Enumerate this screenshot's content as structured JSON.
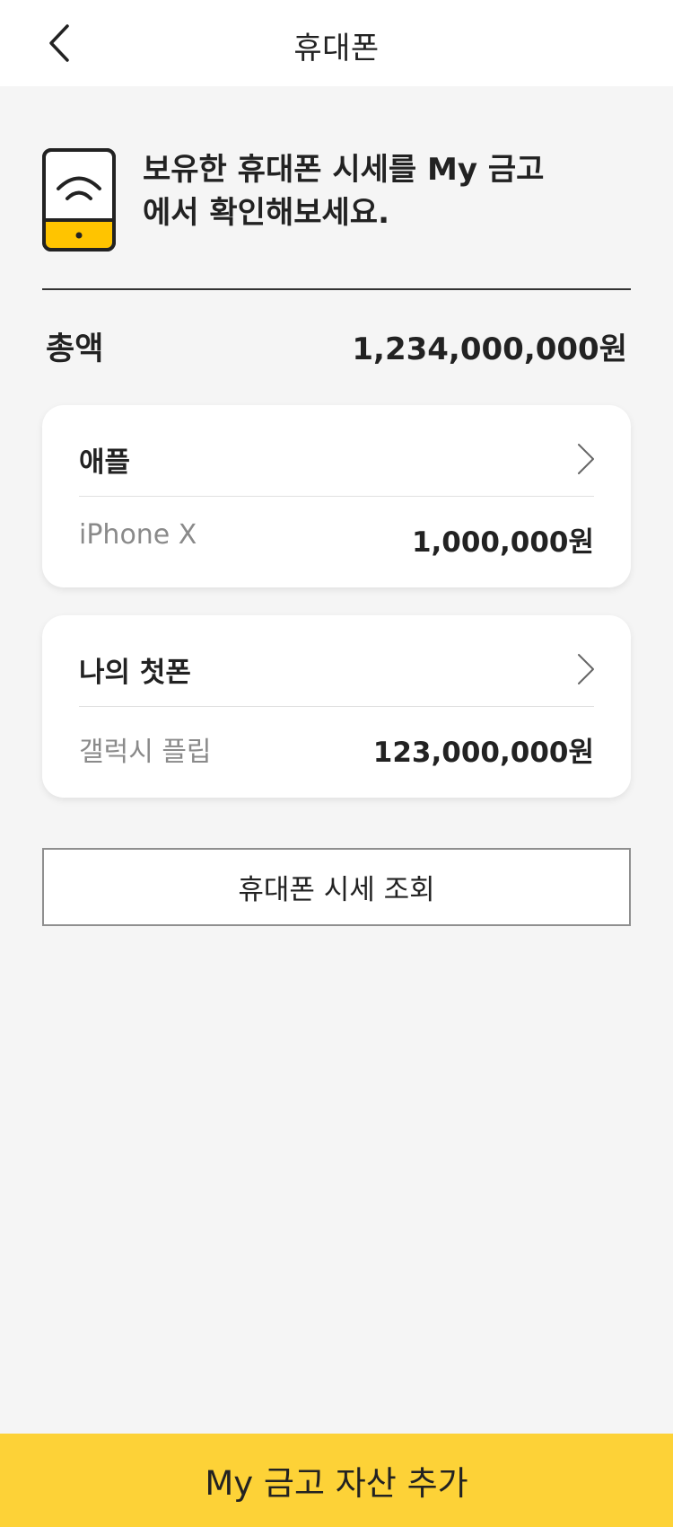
{
  "header": {
    "title": "휴대폰",
    "back_icon": "chevron-left-icon"
  },
  "intro": {
    "icon": "phone-wifi-icon",
    "icon_accent_color": "#FFC400",
    "text": "보유한 휴대폰 시세를 My 금고\n에서 확인해보세요."
  },
  "summary": {
    "total_label": "총액",
    "total_value": "1,234,000,000원"
  },
  "phones": [
    {
      "title": "애플",
      "model": "iPhone X",
      "price": "1,000,000원"
    },
    {
      "title": "나의 첫폰",
      "model": "갤럭시 플립",
      "price": "123,000,000원"
    }
  ],
  "lookup_button_label": "휴대폰 시세 조회",
  "cta": {
    "label": "My 금고 자산 추가",
    "color": "#FDD237"
  }
}
